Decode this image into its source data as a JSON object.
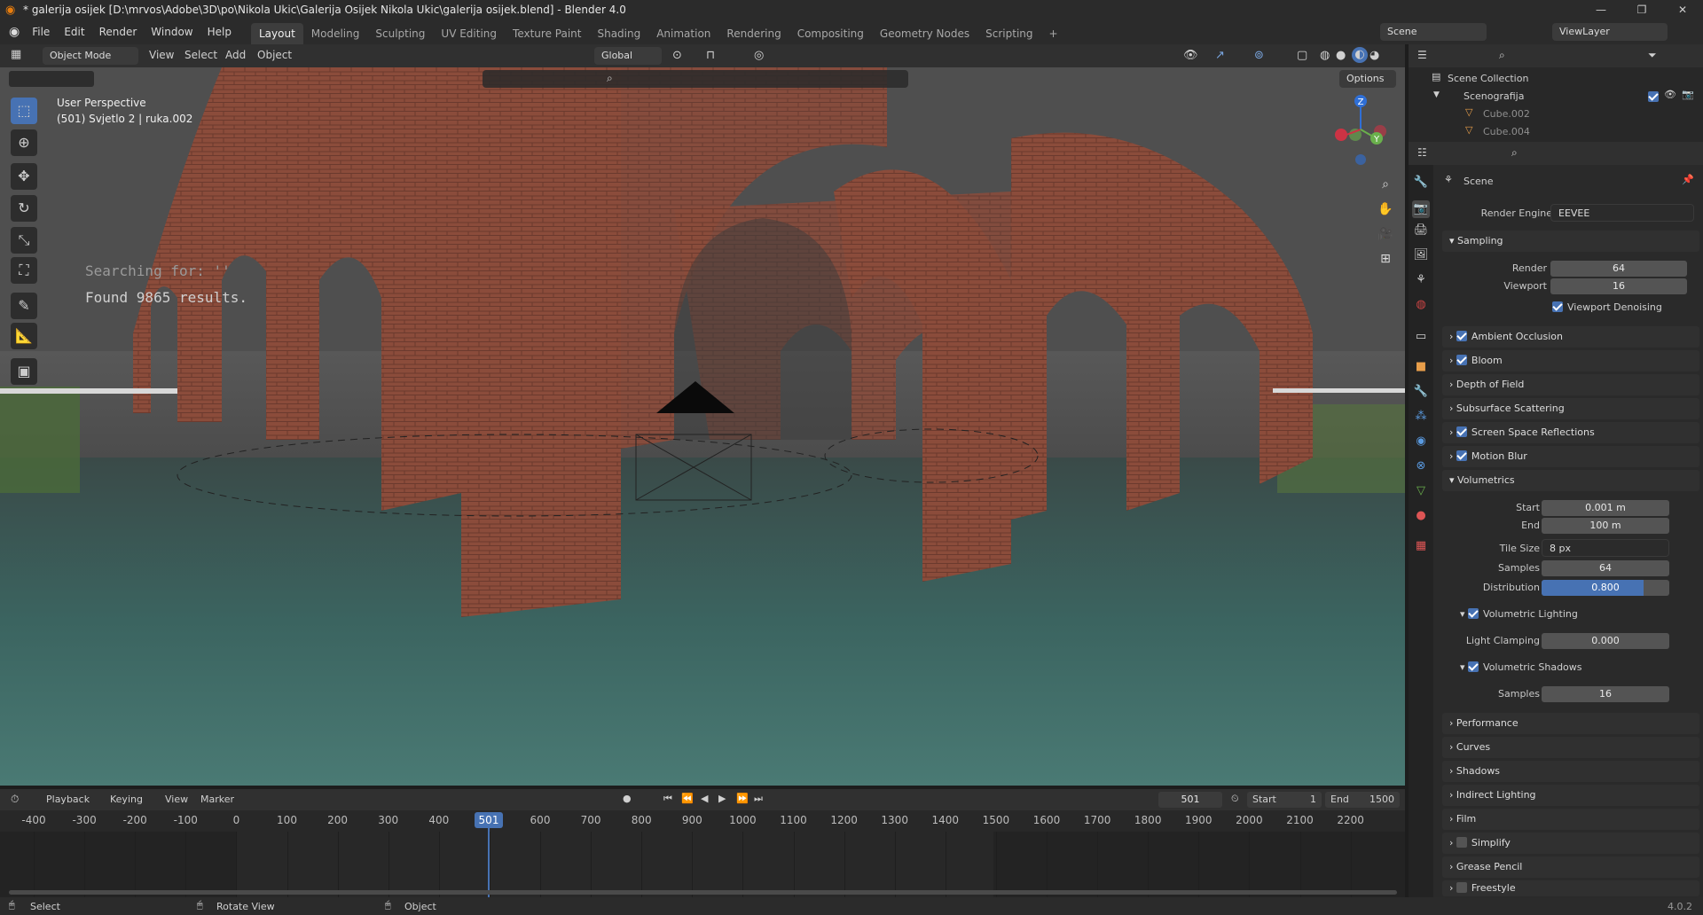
{
  "window": {
    "title": "* galerija osijek [D:\\mrvos\\Adobe\\3D\\po\\Nikola Ukic\\Galerija Osijek Nikola Ukic\\galerija osijek.blend] - Blender 4.0"
  },
  "menu": [
    "File",
    "Edit",
    "Render",
    "Window",
    "Help"
  ],
  "workspaces": [
    "Layout",
    "Modeling",
    "Sculpting",
    "UV Editing",
    "Texture Paint",
    "Shading",
    "Animation",
    "Rendering",
    "Compositing",
    "Geometry Nodes",
    "Scripting"
  ],
  "active_workspace": "Layout",
  "scene_selector": "Scene",
  "viewlayer_selector": "ViewLayer",
  "viewport": {
    "mode": "Object Mode",
    "menus": [
      "View",
      "Select",
      "Add",
      "Object"
    ],
    "transform_orientation": "Global",
    "options_label": "Options",
    "overlay_title": "User Perspective",
    "overlay_subtitle": "(501) Svjetlo 2 | ruka.002",
    "search_line1": "Searching for: ''",
    "search_line2": "Found 9865 results."
  },
  "outliner": {
    "root": "Scene Collection",
    "collection": "Scenografija",
    "items": [
      "Cube.002",
      "Cube.004"
    ]
  },
  "properties": {
    "context": "Scene",
    "render_engine_label": "Render Engine",
    "render_engine": "EEVEE",
    "sampling": {
      "label": "Sampling",
      "render_label": "Render",
      "render": "64",
      "viewport_label": "Viewport",
      "viewport": "16",
      "denoise_label": "Viewport Denoising"
    },
    "panels_checked": [
      "Ambient Occlusion",
      "Bloom"
    ],
    "dof": "Depth of Field",
    "sss": "Subsurface Scattering",
    "ssr": "Screen Space Reflections",
    "motion_blur": "Motion Blur",
    "volumetrics": {
      "label": "Volumetrics",
      "start_label": "Start",
      "start": "0.001 m",
      "end_label": "End",
      "end": "100 m",
      "tile_label": "Tile Size",
      "tile": "8 px",
      "samples_label": "Samples",
      "samples": "64",
      "distribution_label": "Distribution",
      "distribution": "0.800",
      "distribution_fraction": 0.8,
      "lighting_label": "Volumetric Lighting",
      "clamp_label": "Light Clamping",
      "clamp": "0.000",
      "shadows_label": "Volumetric Shadows",
      "shadow_samples_label": "Samples",
      "shadow_samples": "16"
    },
    "collapsed_panels": [
      "Performance",
      "Curves",
      "Shadows",
      "Indirect Lighting",
      "Film",
      "Simplify",
      "Grease Pencil",
      "Freestyle"
    ]
  },
  "timeline": {
    "menus": [
      "Playback",
      "Keying",
      "View",
      "Marker"
    ],
    "current_frame": "501",
    "start_label": "Start",
    "start": "1",
    "end_label": "End",
    "end": "1500",
    "ticks": [
      "-400",
      "-300",
      "-200",
      "-100",
      "0",
      "100",
      "200",
      "300",
      "400",
      "501",
      "600",
      "700",
      "800",
      "900",
      "1000",
      "1100",
      "1200",
      "1300",
      "1400",
      "1500",
      "1600",
      "1700",
      "1800",
      "1900",
      "2000",
      "2100",
      "2200"
    ]
  },
  "statusbar": {
    "select": "Select",
    "rotate": "Rotate View",
    "object": "Object",
    "version": "4.0.2"
  },
  "colors": {
    "accent": "#4772b3",
    "brick": "#8a4a3a",
    "water": "#3e6a66"
  }
}
